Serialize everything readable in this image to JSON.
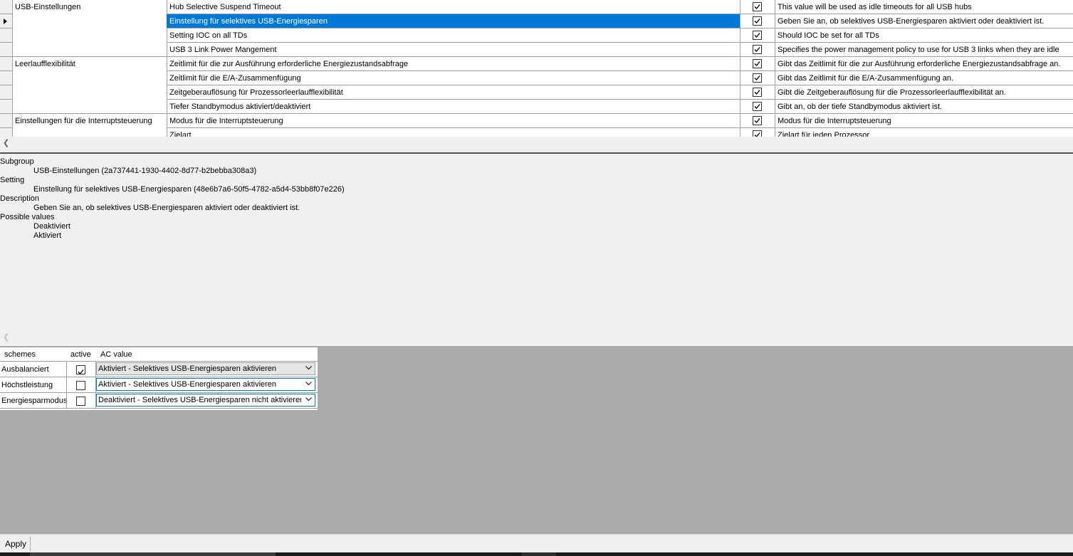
{
  "grid": {
    "rows": [
      {
        "subgroup": "USB-Einstellungen",
        "setting": "Hub Selective Suspend Timeout",
        "checked": true,
        "description": "This value will be used as idle timeouts for all USB hubs"
      },
      {
        "subgroup": "",
        "setting": "Einstellung für selektives USB-Energiesparen",
        "checked": true,
        "description": "Geben Sie an, ob selektives USB-Energiesparen aktiviert oder deaktiviert ist."
      },
      {
        "subgroup": "",
        "setting": "Setting IOC on all TDs",
        "checked": true,
        "description": "Should IOC be set for all TDs"
      },
      {
        "subgroup": "",
        "setting": "USB 3 Link Power Mangement",
        "checked": true,
        "description": "Specifies the power management policy to use for USB 3 links when they are idle"
      },
      {
        "subgroup": "Leerlaufflexibilität",
        "setting": "Zeitlimit für die zur Ausführung erforderliche Energiezustandsabfrage",
        "checked": true,
        "description": "Gibt das Zeitlimit für die zur Ausführung erforderliche Energiezustandsabfrage an."
      },
      {
        "subgroup": "",
        "setting": "Zeitlimit für die E/A-Zusammenfügung",
        "checked": true,
        "description": "Gibt das Zeitlimit für die E/A-Zusammenfügung an."
      },
      {
        "subgroup": "",
        "setting": "Zeitgeberauflösung für Prozessorleerlaufflexibilität",
        "checked": true,
        "description": "Gibt die Zeitgeberauflösung für die Prozessorleerlaufflexibilität an."
      },
      {
        "subgroup": "",
        "setting": "Tiefer Standbymodus aktiviert/deaktiviert",
        "checked": true,
        "description": "Gibt an, ob der tiefe Standbymodus aktiviert ist."
      },
      {
        "subgroup": "Einstellungen für die Interruptsteuerung",
        "setting": "Modus für die Interruptsteuerung",
        "checked": true,
        "description": "Modus für die Interruptsteuerung"
      },
      {
        "subgroup": "",
        "setting": "Zielart",
        "checked": true,
        "description": "Zielart für jeden Prozessor"
      }
    ]
  },
  "details": {
    "subgroup_label": "Subgroup",
    "subgroup_value": "USB-Einstellungen (2a737441-1930-4402-8d77-b2bebba308a3)",
    "setting_label": "Setting",
    "setting_value": "Einstellung für selektives USB-Energiesparen (48e6b7a6-50f5-4782-a5d4-53bb8f07e226)",
    "description_label": "Description",
    "description_value": "Geben Sie an, ob selektives USB-Energiesparen aktiviert oder deaktiviert ist.",
    "possible_values_label": "Possible values",
    "possible_values": [
      "Deaktiviert",
      "Aktiviert"
    ]
  },
  "schemes": {
    "headers": {
      "name": "schemes",
      "active": "active",
      "ac": "AC value"
    },
    "rows": [
      {
        "name": "Ausbalanciert",
        "active": true,
        "ac_value": "Aktiviert - Selektives USB-Energiesparen aktivieren"
      },
      {
        "name": "Höchstleistung",
        "active": false,
        "ac_value": "Aktiviert - Selektives USB-Energiesparen aktivieren"
      },
      {
        "name": "Energiesparmodus",
        "active": false,
        "ac_value": "Deaktiviert - Selektives USB-Energiesparen nicht aktivieren"
      }
    ]
  },
  "toolbar": {
    "apply_label": "Apply"
  },
  "icons": {
    "row_indicator": "triangle-right-icon",
    "scroll_left": "chevron-left-icon",
    "dropdown": "chevron-down-icon",
    "check": "checkmark-icon"
  },
  "colors": {
    "selection": "#0078d7",
    "panel_bg": "#ababab",
    "window_bg": "#f0f0f0",
    "grid_line": "#a0a0a0"
  }
}
